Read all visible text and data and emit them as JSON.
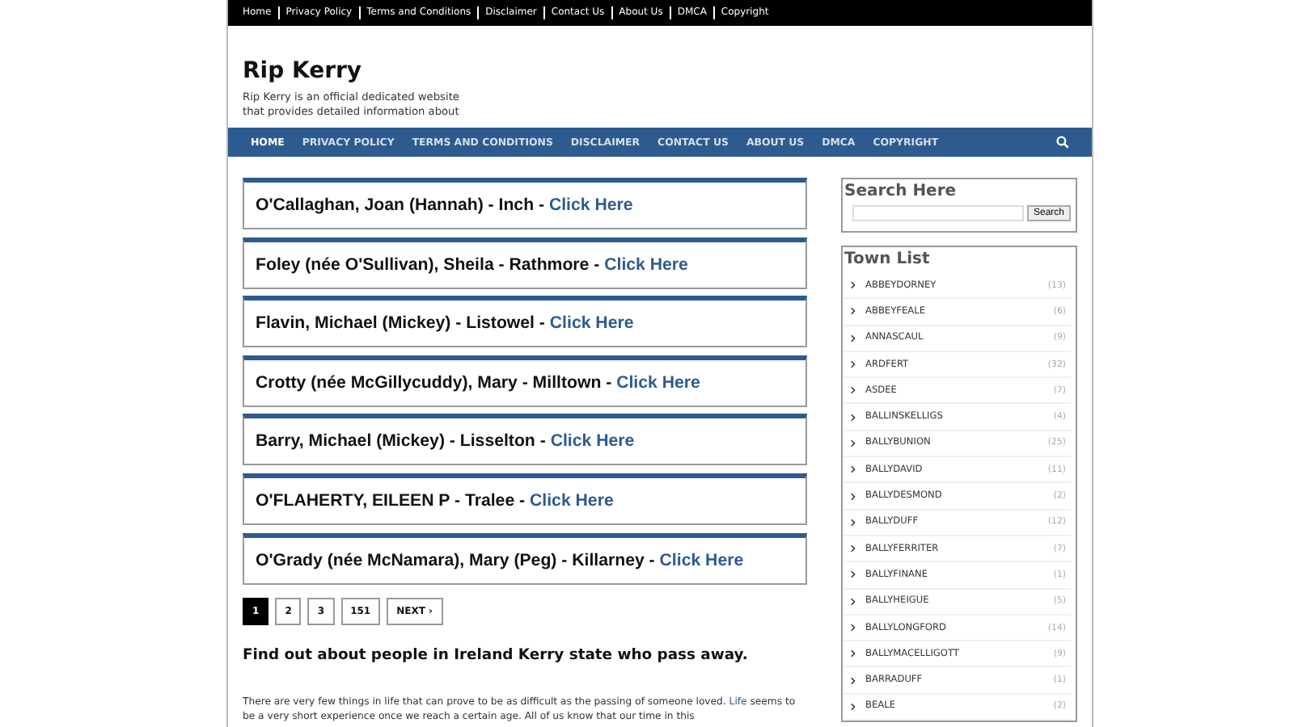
{
  "top_links": [
    "Home",
    "Privacy Policy",
    "Terms and Conditions",
    "Disclaimer",
    "Contact Us",
    "About Us",
    "DMCA",
    "Copyright"
  ],
  "site": {
    "title": "Rip Kerry",
    "tagline_lines": [
      "Rip Kerry is an official dedicated website",
      "that provides detailed information about"
    ]
  },
  "nav": [
    {
      "label": "HOME",
      "selected": true
    },
    {
      "label": "PRIVACY POLICY",
      "selected": false
    },
    {
      "label": "TERMS AND CONDITIONS",
      "selected": false
    },
    {
      "label": "DISCLAIMER",
      "selected": false
    },
    {
      "label": "CONTACT US",
      "selected": false
    },
    {
      "label": "ABOUT US",
      "selected": false
    },
    {
      "label": "DMCA",
      "selected": false
    },
    {
      "label": "COPYRIGHT",
      "selected": false
    }
  ],
  "posts": [
    {
      "title": "O'Callaghan, Joan (Hannah) - Inch - ",
      "link": "Click Here"
    },
    {
      "title": "Foley (née O'Sullivan), Sheila - Rathmore - ",
      "link": "Click Here"
    },
    {
      "title": "Flavin, Michael (Mickey) - Listowel - ",
      "link": "Click Here"
    },
    {
      "title": "Crotty (née McGillycuddy), Mary - Milltown - ",
      "link": "Click Here"
    },
    {
      "title": "Barry, Michael (Mickey) - Lisselton - ",
      "link": "Click Here"
    },
    {
      "title": "O'FLAHERTY, EILEEN P - Tralee - ",
      "link": "Click Here"
    },
    {
      "title": "O'Grady (née McNamara), Mary (Peg) - Killarney - ",
      "link": "Click Here"
    }
  ],
  "pagination": [
    {
      "label": "1",
      "selected": true
    },
    {
      "label": "2",
      "selected": false
    },
    {
      "label": "3",
      "selected": false
    },
    {
      "label": "151",
      "selected": false
    },
    {
      "label": "NEXT ›",
      "selected": false
    }
  ],
  "intro": {
    "heading": "Find out about people in Ireland Kerry state who pass away.",
    "text_before": "There are very few things in life that can prove to be as difficult as the passing of someone loved. ",
    "link": "Life",
    "text_after": " seems to be a very short experience once we reach a certain age. All of us know that our time in this"
  },
  "search_widget": {
    "title": "Search Here",
    "button": "Search"
  },
  "town_list": {
    "title": "Town List",
    "items": [
      {
        "name": "ABBEYDORNEY",
        "count": "(13)"
      },
      {
        "name": "ABBEYFEALE",
        "count": "(6)"
      },
      {
        "name": "ANNASCAUL",
        "count": "(9)"
      },
      {
        "name": "ARDFERT",
        "count": "(32)"
      },
      {
        "name": "ASDEE",
        "count": "(7)"
      },
      {
        "name": "BALLINSKELLIGS",
        "count": "(4)"
      },
      {
        "name": "BALLYBUNION",
        "count": "(25)"
      },
      {
        "name": "BALLYDAVID",
        "count": "(11)"
      },
      {
        "name": "BALLYDESMOND",
        "count": "(2)"
      },
      {
        "name": "BALLYDUFF",
        "count": "(12)"
      },
      {
        "name": "BALLYFERRITER",
        "count": "(7)"
      },
      {
        "name": "BALLYFINANE",
        "count": "(1)"
      },
      {
        "name": "BALLYHEIGUE",
        "count": "(5)"
      },
      {
        "name": "BALLYLONGFORD",
        "count": "(14)"
      },
      {
        "name": "BALLYMACELLIGOTT",
        "count": "(9)"
      },
      {
        "name": "BARRADUFF",
        "count": "(1)"
      },
      {
        "name": "BEALE",
        "count": "(2)"
      }
    ]
  }
}
